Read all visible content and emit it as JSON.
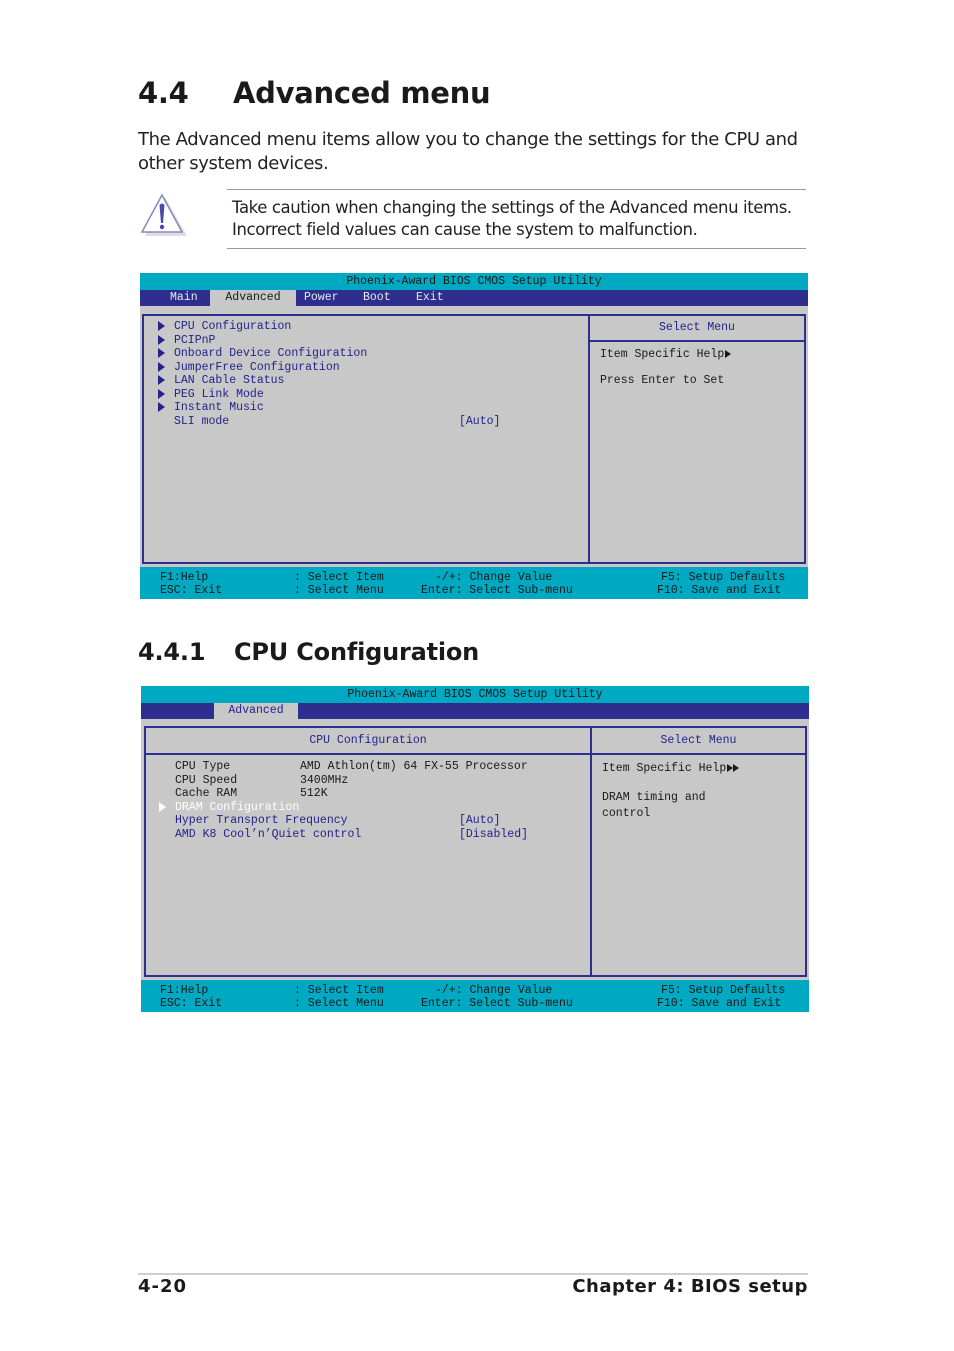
{
  "section": {
    "number": "4.4",
    "title": "Advanced menu",
    "intro": "The Advanced menu items allow you to change the settings for the CPU and other system devices.",
    "caution": {
      "icon": "warning-icon",
      "text": "Take caution when changing the settings of the Advanced menu items. Incorrect field values can cause the system to malfunction."
    }
  },
  "bios1": {
    "title": "Phoenix-Award BIOS CMOS Setup Utility",
    "menu": [
      {
        "label": "Main",
        "active": false
      },
      {
        "label": "Advanced",
        "active": true
      },
      {
        "label": "Power",
        "active": false
      },
      {
        "label": "Boot",
        "active": false
      },
      {
        "label": "Exit",
        "active": false
      }
    ],
    "items": [
      {
        "label": "CPU Configuration",
        "submenu": true
      },
      {
        "label": "PCIPnP",
        "submenu": true
      },
      {
        "label": "Onboard Device Configuration",
        "submenu": true
      },
      {
        "label": "JumperFree Configuration",
        "submenu": true
      },
      {
        "label": "LAN Cable Status",
        "submenu": true
      },
      {
        "label": "PEG Link Mode",
        "submenu": true
      },
      {
        "label": "Instant Music",
        "submenu": true
      },
      {
        "label": "SLI mode",
        "submenu": false,
        "value": "[Auto]"
      }
    ],
    "help": {
      "title": "Select Menu",
      "item_help": "Item Specific Help",
      "text": "Press Enter to Set"
    }
  },
  "keys": {
    "f1": "F1:Help",
    "esc": "ESC: Exit",
    "select_item": ": Select Item",
    "select_menu": ": Select Menu",
    "change_value": "-/+: Change Value",
    "enter": "Enter: Select Sub-menu",
    "f5": "F5: Setup Defaults",
    "f10": "F10: Save and Exit"
  },
  "subsection": {
    "number": "4.4.1",
    "title": "CPU Configuration"
  },
  "bios2": {
    "title": "Phoenix-Award BIOS CMOS Setup Utility",
    "menu_active": "Advanced",
    "pane_title": "CPU Configuration",
    "info": [
      {
        "label": "CPU Type",
        "value": "AMD Athlon(tm) 64 FX-55 Processor"
      },
      {
        "label": "CPU Speed",
        "value": "3400MHz"
      },
      {
        "label": "Cache RAM",
        "value": "512K"
      }
    ],
    "items": [
      {
        "label": "DRAM Configuration",
        "submenu": true,
        "highlighted": true
      },
      {
        "label": "Hyper Transport Frequency",
        "value": "[Auto]"
      },
      {
        "label": "AMD K8 Cool’n’Quiet control",
        "value": "[Disabled]"
      }
    ],
    "help": {
      "title": "Select Menu",
      "item_help": "Item Specific Help",
      "text_line1": "DRAM timing and",
      "text_line2": "control"
    }
  },
  "footer": {
    "page": "4-20",
    "chapter": "Chapter 4: BIOS setup"
  }
}
